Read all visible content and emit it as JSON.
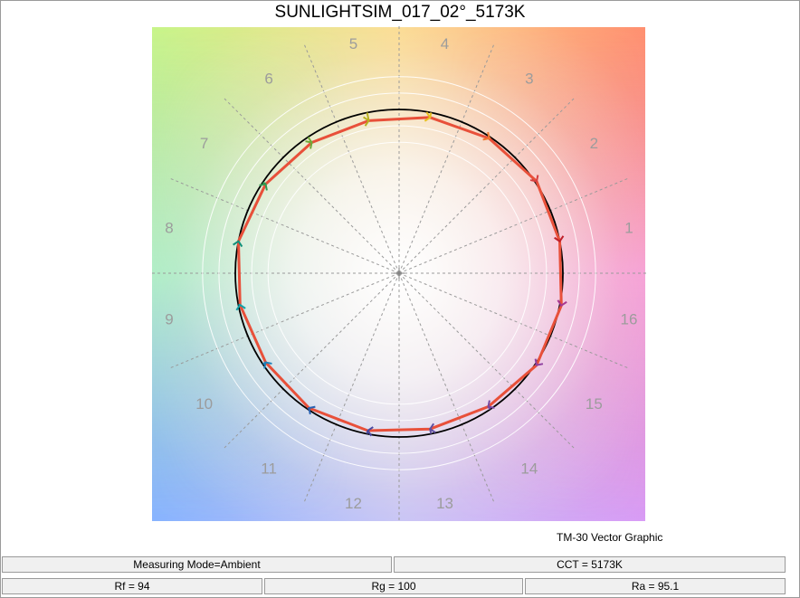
{
  "title": "SUNLIGHTSIM_017_02°_5173K",
  "caption": "TM-30 Vector Graphic",
  "status": {
    "measuring_mode": "Measuring Mode=Ambient",
    "cct": "CCT = 5173K",
    "rf": "Rf = 94",
    "rg": "Rg = 100",
    "ra": "Ra = 95.1"
  },
  "chart_data": {
    "type": "polar-vector",
    "title": "SUNLIGHTSIM_017_02°_5173K",
    "hue_bins": [
      "1",
      "2",
      "3",
      "4",
      "5",
      "6",
      "7",
      "8",
      "9",
      "10",
      "11",
      "12",
      "13",
      "14",
      "15",
      "16"
    ],
    "reference_radius": 1.0,
    "test_radius": [
      1.0,
      1.01,
      0.99,
      0.97,
      0.95,
      0.96,
      0.98,
      1.0,
      0.99,
      0.98,
      0.99,
      0.98,
      0.97,
      0.98,
      1.01,
      1.01
    ],
    "grid_rings": [
      0.8,
      0.9,
      1.1,
      1.2
    ],
    "grid": true,
    "colors": {
      "reference_circle": "#000000",
      "test_polygon": "#e8503a",
      "grid": "#9a9a9a",
      "bin_label": "#9c9c9c"
    },
    "bin_arrow_colors": [
      "#c0202a",
      "#d64040",
      "#f07830",
      "#e8c020",
      "#b8b020",
      "#70a838",
      "#309a50",
      "#10907a",
      "#10a0a8",
      "#2080b8",
      "#2860b0",
      "#4848a0",
      "#6050a0",
      "#7848a0",
      "#9040a0",
      "#a83890"
    ]
  }
}
